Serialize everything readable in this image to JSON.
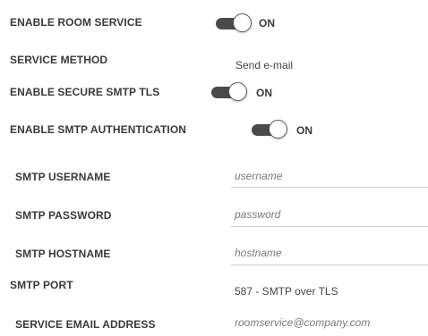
{
  "settings": {
    "enable_room_service": {
      "label": "ENABLE ROOM SERVICE",
      "state": "ON"
    },
    "service_method": {
      "label": "SERVICE METHOD",
      "value": "Send e-mail"
    },
    "enable_secure_smtp_tls": {
      "label": "ENABLE SECURE SMTP TLS",
      "state": "ON"
    },
    "enable_smtp_authentication": {
      "label": "ENABLE SMTP AUTHENTICATION",
      "state": "ON"
    },
    "smtp_username": {
      "label": "SMTP USERNAME",
      "placeholder": "username"
    },
    "smtp_password": {
      "label": "SMTP PASSWORD",
      "placeholder": "password"
    },
    "smtp_hostname": {
      "label": "SMTP HOSTNAME",
      "placeholder": "hostname"
    },
    "smtp_port": {
      "label": "SMTP PORT",
      "value": "587 - SMTP over TLS"
    },
    "service_email_address": {
      "label": "SERVICE EMAIL ADDRESS",
      "placeholder": "roomservice@company.com"
    }
  },
  "colors": {
    "toggle_track": "#4a4a4a",
    "label_text": "#3a3a3a",
    "placeholder_text": "#7a7a7a"
  }
}
